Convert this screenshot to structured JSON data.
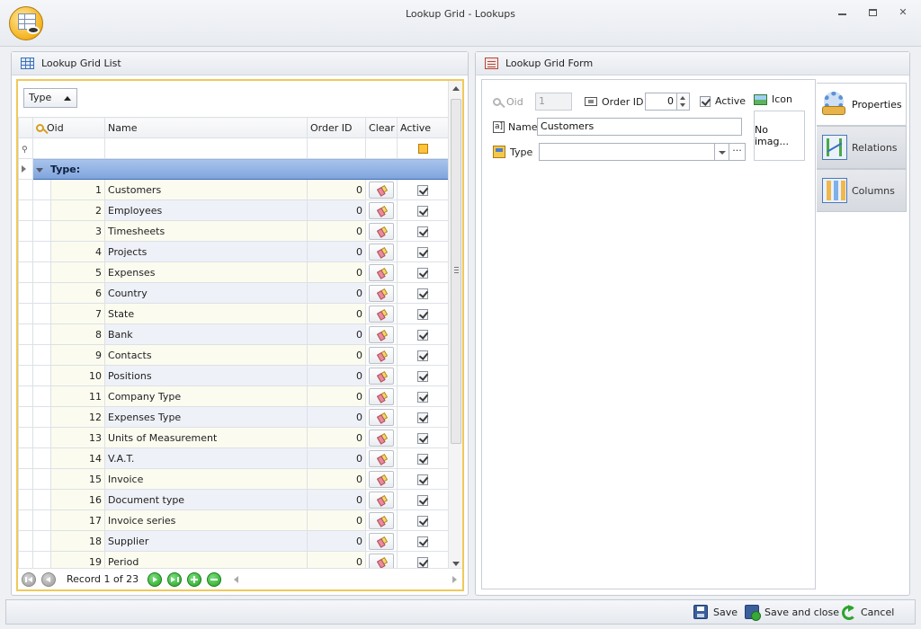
{
  "window": {
    "title": "Lookup Grid - Lookups",
    "minimize_label": "",
    "close_label": "✕"
  },
  "left_panel": {
    "title": "Lookup Grid List",
    "group_chip": "Type",
    "columns": {
      "oid": "Oid",
      "name": "Name",
      "order_id": "Order ID",
      "clear": "Clear",
      "active": "Active"
    },
    "group_row_label": "Type:",
    "rows": [
      {
        "oid": "1",
        "name": "Customers",
        "order_id": "0",
        "active": true
      },
      {
        "oid": "2",
        "name": "Employees",
        "order_id": "0",
        "active": true
      },
      {
        "oid": "3",
        "name": "Timesheets",
        "order_id": "0",
        "active": true
      },
      {
        "oid": "4",
        "name": "Projects",
        "order_id": "0",
        "active": true
      },
      {
        "oid": "5",
        "name": "Expenses",
        "order_id": "0",
        "active": true
      },
      {
        "oid": "6",
        "name": "Country",
        "order_id": "0",
        "active": true
      },
      {
        "oid": "7",
        "name": "State",
        "order_id": "0",
        "active": true
      },
      {
        "oid": "8",
        "name": "Bank",
        "order_id": "0",
        "active": true
      },
      {
        "oid": "9",
        "name": "Contacts",
        "order_id": "0",
        "active": true
      },
      {
        "oid": "10",
        "name": "Positions",
        "order_id": "0",
        "active": true
      },
      {
        "oid": "11",
        "name": "Company Type",
        "order_id": "0",
        "active": true
      },
      {
        "oid": "12",
        "name": "Expenses Type",
        "order_id": "0",
        "active": true
      },
      {
        "oid": "13",
        "name": "Units of Measurement",
        "order_id": "0",
        "active": true
      },
      {
        "oid": "14",
        "name": "V.A.T.",
        "order_id": "0",
        "active": true
      },
      {
        "oid": "15",
        "name": "Invoice",
        "order_id": "0",
        "active": true
      },
      {
        "oid": "16",
        "name": "Document type",
        "order_id": "0",
        "active": true
      },
      {
        "oid": "17",
        "name": "Invoice series",
        "order_id": "0",
        "active": true
      },
      {
        "oid": "18",
        "name": "Supplier",
        "order_id": "0",
        "active": true
      },
      {
        "oid": "19",
        "name": "Period",
        "order_id": "0",
        "active": true
      }
    ],
    "navigator": {
      "record_text": "Record 1 of 23"
    }
  },
  "right_panel": {
    "title": "Lookup Grid Form",
    "oid_label": "Oid",
    "oid_value": "1",
    "order_id_label": "Order ID",
    "order_id_value": "0",
    "active_label": "Active",
    "active_checked": true,
    "icon_label": "Icon",
    "image_placeholder": "No imag...",
    "name_label": "Name",
    "name_value": "Customers",
    "type_label": "Type",
    "type_value": "",
    "type_more": "···",
    "tabs": [
      {
        "label": "Properties",
        "icon": "gear-icon",
        "active": true
      },
      {
        "label": "Relations",
        "icon": "relations-icon",
        "active": false
      },
      {
        "label": "Columns",
        "icon": "columns-icon",
        "active": false
      }
    ]
  },
  "statusbar": {
    "save": "Save",
    "save_close": "Save and close",
    "cancel": "Cancel"
  }
}
